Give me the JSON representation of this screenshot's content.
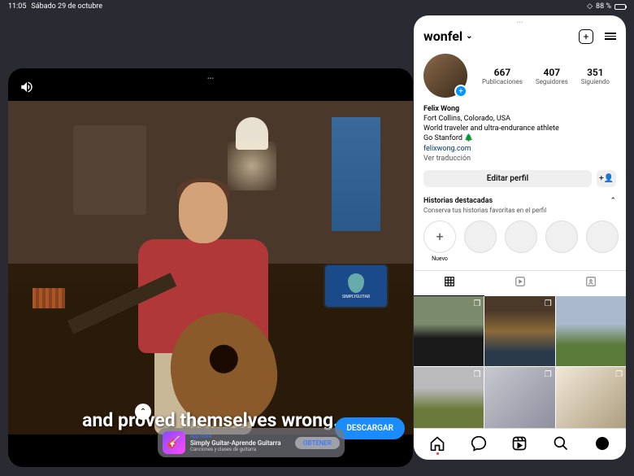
{
  "status": {
    "time": "11:05",
    "date": "Sábado 29 de octubre",
    "battery": "88 %"
  },
  "video": {
    "caption": "and proved themselves wrong.",
    "download": "DESCARGAR",
    "tablet_brand": "SIMPLYGUITAR"
  },
  "app_banner": {
    "category": "App Store",
    "title": "Simply Guitar-Aprende Guitarra",
    "subtitle": "Canciones y clases de guitarra",
    "button": "OBTENER"
  },
  "ig": {
    "username": "wonfel",
    "stats": [
      {
        "num": "667",
        "label": "Publicaciones"
      },
      {
        "num": "407",
        "label": "Seguidores"
      },
      {
        "num": "351",
        "label": "Siguiendo"
      }
    ],
    "bio": {
      "name": "Felix Wong",
      "location": "Fort Collins, Colorado, USA",
      "line": "World traveler and ultra-endurance athlete",
      "tag": "Go Stanford 🌲",
      "link": "felixwong.com",
      "translate": "Ver traducción"
    },
    "edit": "Editar perfil",
    "highlights": {
      "title": "Historias destacadas",
      "subtitle": "Conserva tus historias favoritas en el perfil",
      "new": "Nuevo"
    }
  }
}
